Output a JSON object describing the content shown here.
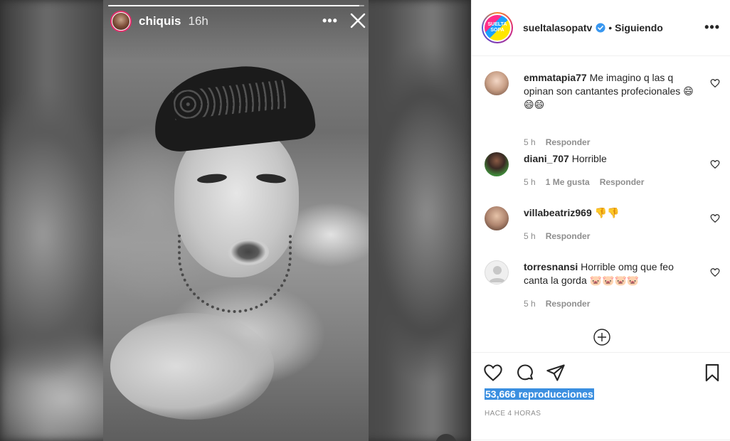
{
  "story": {
    "username": "chiquis",
    "time": "16h",
    "more_icon": "more-horizontal-icon",
    "close_icon": "close-icon",
    "progress": 0.98
  },
  "post": {
    "account": "sueltalasopatv",
    "avatar_text_1": "SUELTA",
    "avatar_text_2": "SOPA",
    "separator": "•",
    "follow_state": "Siguiendo",
    "comments": [
      {
        "user": "emmatapia77",
        "text": "Me imagino q las q opinan son cantantes profecionales 😄😄😄",
        "time": "5 h",
        "likes": "",
        "reply": "Responder"
      },
      {
        "user": "diani_707",
        "text": "Horrible",
        "time": "5 h",
        "likes": "1 Me gusta",
        "reply": "Responder"
      },
      {
        "user": "villabeatriz969",
        "text": "👎👎",
        "time": "5 h",
        "likes": "",
        "reply": "Responder"
      },
      {
        "user": "torresnansi",
        "text": "Horrible omg que feo canta la gorda 🐷🐷🐷🐷",
        "time": "5 h",
        "likes": "",
        "reply": "Responder"
      }
    ],
    "views": "53,666 reproducciones",
    "time_ago": "HACE 4 HORAS"
  },
  "colors": {
    "text": "#262626",
    "meta": "#8e8e8e",
    "verified": "#3897f0",
    "highlight": "#3b8fe0"
  }
}
